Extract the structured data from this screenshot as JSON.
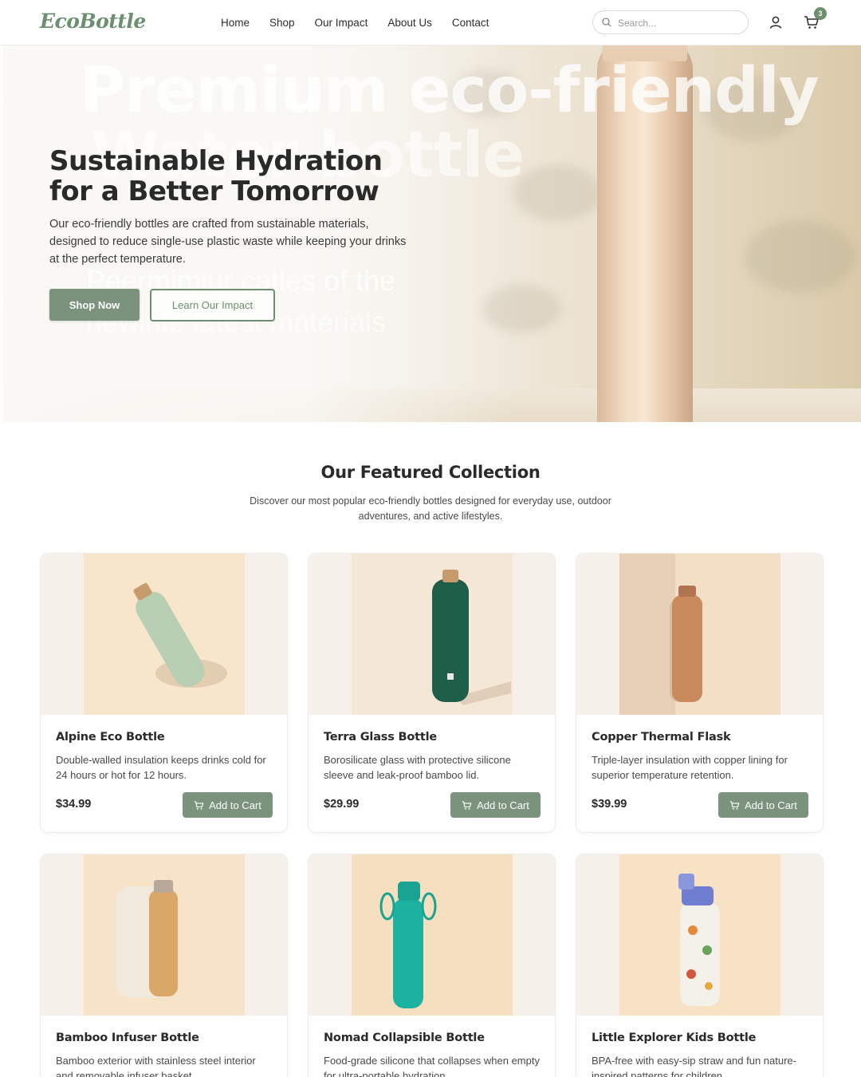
{
  "brand": {
    "logo": "EcoBottle"
  },
  "nav": {
    "items": [
      "Home",
      "Shop",
      "Our Impact",
      "About Us",
      "Contact"
    ]
  },
  "search": {
    "placeholder": "Search..."
  },
  "cart": {
    "count": "3"
  },
  "hero": {
    "title": "Sustainable Hydration for a Better Tomorrow",
    "text": "Our eco-friendly bottles are crafted from sustainable materials, designed to reduce single-use plastic waste while keeping your drinks at the perfect temperature.",
    "primary_button": "Shop Now",
    "secondary_button": "Learn Our Impact",
    "bg_text_line1": "Premium eco-friendly",
    "bg_text_line2": "Water bottle",
    "bg_text_line3": "Peermimiur catles of the",
    "bg_text_line4": "newinte latest materials"
  },
  "featured": {
    "title": "Our Featured Collection",
    "subtitle": "Discover our most popular eco-friendly bottles designed for everyday use, outdoor adventures, and active lifestyles.",
    "add_label": "Add to Cart",
    "products": [
      {
        "name": "Alpine Eco Bottle",
        "desc": "Double-walled insulation keeps drinks cold for 24 hours or hot for 12 hours.",
        "price": "$34.99",
        "color": "#b8cfb3"
      },
      {
        "name": "Terra Glass Bottle",
        "desc": "Borosilicate glass with protective silicone sleeve and leak-proof bamboo lid.",
        "price": "$29.99",
        "color": "#1f5e48"
      },
      {
        "name": "Copper Thermal Flask",
        "desc": "Triple-layer insulation with copper lining for superior temperature retention.",
        "price": "$39.99",
        "color": "#c98a5e"
      },
      {
        "name": "Bamboo Infuser Bottle",
        "desc": "Bamboo exterior with stainless steel interior and removable infuser basket.",
        "price": "",
        "color": "#d9a867"
      },
      {
        "name": "Nomad Collapsible Bottle",
        "desc": "Food-grade silicone that collapses when empty for ultra-portable hydration.",
        "price": "",
        "color": "#1bb29f"
      },
      {
        "name": "Little Explorer Kids Bottle",
        "desc": "BPA-free with easy-sip straw and fun nature-inspired patterns for children.",
        "price": "",
        "color": "#f4f1ea"
      }
    ]
  },
  "colors": {
    "accent": "#7b937d",
    "brand": "#6c8f6f"
  }
}
